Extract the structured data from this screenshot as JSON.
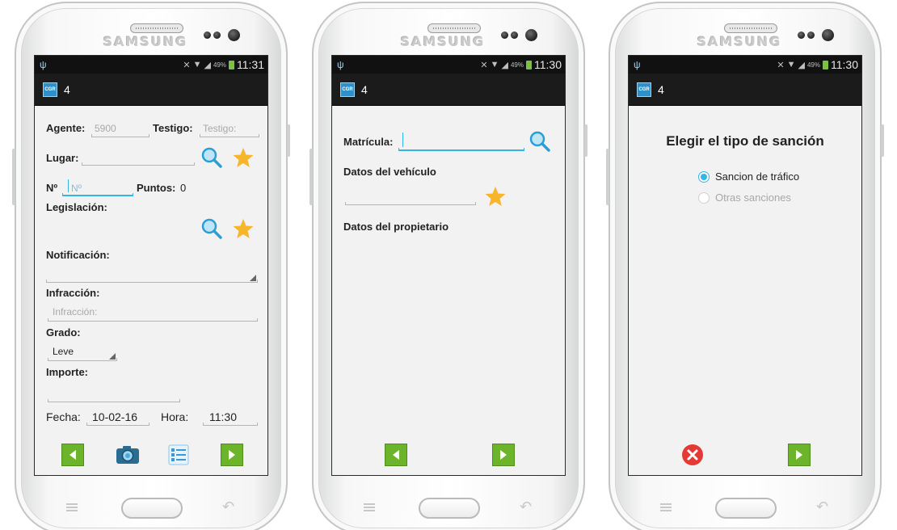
{
  "status_bar": {
    "time_1": "11:31",
    "time_2": "11:30",
    "time_3": "11:30",
    "battery": "49%"
  },
  "device": {
    "brand": "SAMSUNG"
  },
  "app": {
    "icon_text": "CGR",
    "title": "4"
  },
  "screen1": {
    "agente_label": "Agente:",
    "agente_value": "5900",
    "testigo_label": "Testigo:",
    "testigo_placeholder": "Testigo:",
    "lugar_label": "Lugar:",
    "numero_label": "Nº",
    "numero_placeholder": "Nº",
    "puntos_label": "Puntos:",
    "puntos_value": "0",
    "legislacion_label": "Legislación:",
    "notificacion_label": "Notificación:",
    "infraccion_label": "Infracción:",
    "infraccion_placeholder": "Infracción:",
    "grado_label": "Grado:",
    "grado_value": "Leve",
    "importe_label": "Importe:",
    "fecha_label": "Fecha:",
    "fecha_value": "10-02-16",
    "hora_label": "Hora:",
    "hora_value": "11:30"
  },
  "screen2": {
    "matricula_label": "Matrícula:",
    "vehiculo_label": "Datos del vehículo",
    "propietario_label": "Datos del propietario"
  },
  "screen3": {
    "title": "Elegir el tipo de sanción",
    "options": [
      {
        "label": "Sancion de tráfico",
        "checked": true,
        "enabled": true
      },
      {
        "label": "Otras sanciones",
        "checked": false,
        "enabled": false
      }
    ]
  },
  "colors": {
    "accent": "#33b5e5",
    "nav_green": "#6cb52a",
    "star": "#f7b52c",
    "cancel_red": "#e53935"
  },
  "icons": [
    "search-icon",
    "star-icon",
    "camera-icon",
    "list-icon",
    "back-arrow-icon",
    "forward-arrow-icon",
    "cancel-icon"
  ]
}
